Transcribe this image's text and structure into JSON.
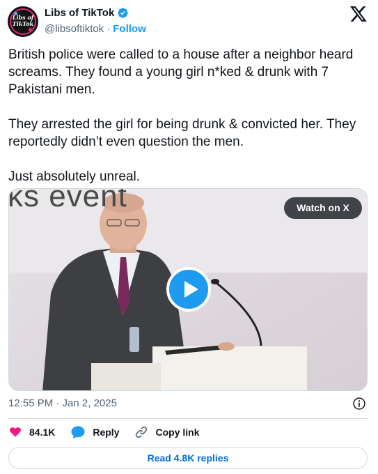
{
  "author": {
    "name": "Libs of TikTok",
    "handle": "@libsoftiktok",
    "separator": "·",
    "follow_label": "Follow",
    "avatar_text_line1": "Libs of",
    "avatar_text_line2": "TikTok",
    "verified": true
  },
  "tweet": {
    "paragraphs": [
      "British police were called to a house after a neighbor heard screams. They found a young girl n*ked & drunk with 7 Pakistani men.",
      "They arrested the girl for being drunk & convicted her. They reportedly didn’t even question the men.",
      "Just absolutely unreal."
    ]
  },
  "media": {
    "watch_label": "Watch on X",
    "backdrop_text": "ks event",
    "play_icon": "play-icon"
  },
  "meta": {
    "timestamp": "12:55 PM · Jan 2, 2025"
  },
  "actions": {
    "likes_count": "84.1K",
    "reply_label": "Reply",
    "copy_link_label": "Copy link",
    "read_replies_label": "Read 4.8K replies"
  },
  "colors": {
    "accent": "#1d9bf0",
    "like": "#f91880",
    "text": "#0f1419",
    "muted": "#536471",
    "border": "#cfd9de",
    "link": "#006fd6"
  }
}
